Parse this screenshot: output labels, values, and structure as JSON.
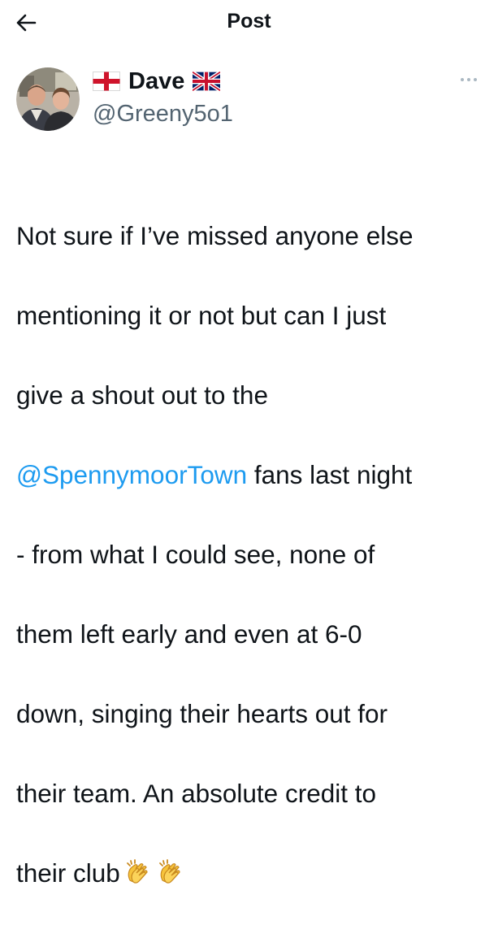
{
  "header": {
    "title": "Post",
    "back_icon": "arrow-left-icon"
  },
  "author": {
    "display_name": "Dave",
    "handle": "@Greeny5o1",
    "flag_before": "england-flag-icon",
    "flag_after": "uk-flag-icon",
    "more_icon": "more-horizontal-icon"
  },
  "tweet": {
    "line1": "Not sure if I’ve missed anyone else",
    "line2": "mentioning it or not but can I just",
    "line3": "give a shout out to the",
    "mention": "@SpennymoorTown",
    "line4_rest": " fans last night",
    "line5": "- from what I could see, none of",
    "line6": "them left early and even at 6-0",
    "line7": "down, singing their hearts out for",
    "line8": "their team. An absolute credit to",
    "line9": "their club",
    "emoji_icon": "clapping-hands-icon"
  },
  "colors": {
    "text": "#0f1419",
    "secondary": "#536471",
    "link": "#1d9bf0",
    "background": "#ffffff"
  }
}
